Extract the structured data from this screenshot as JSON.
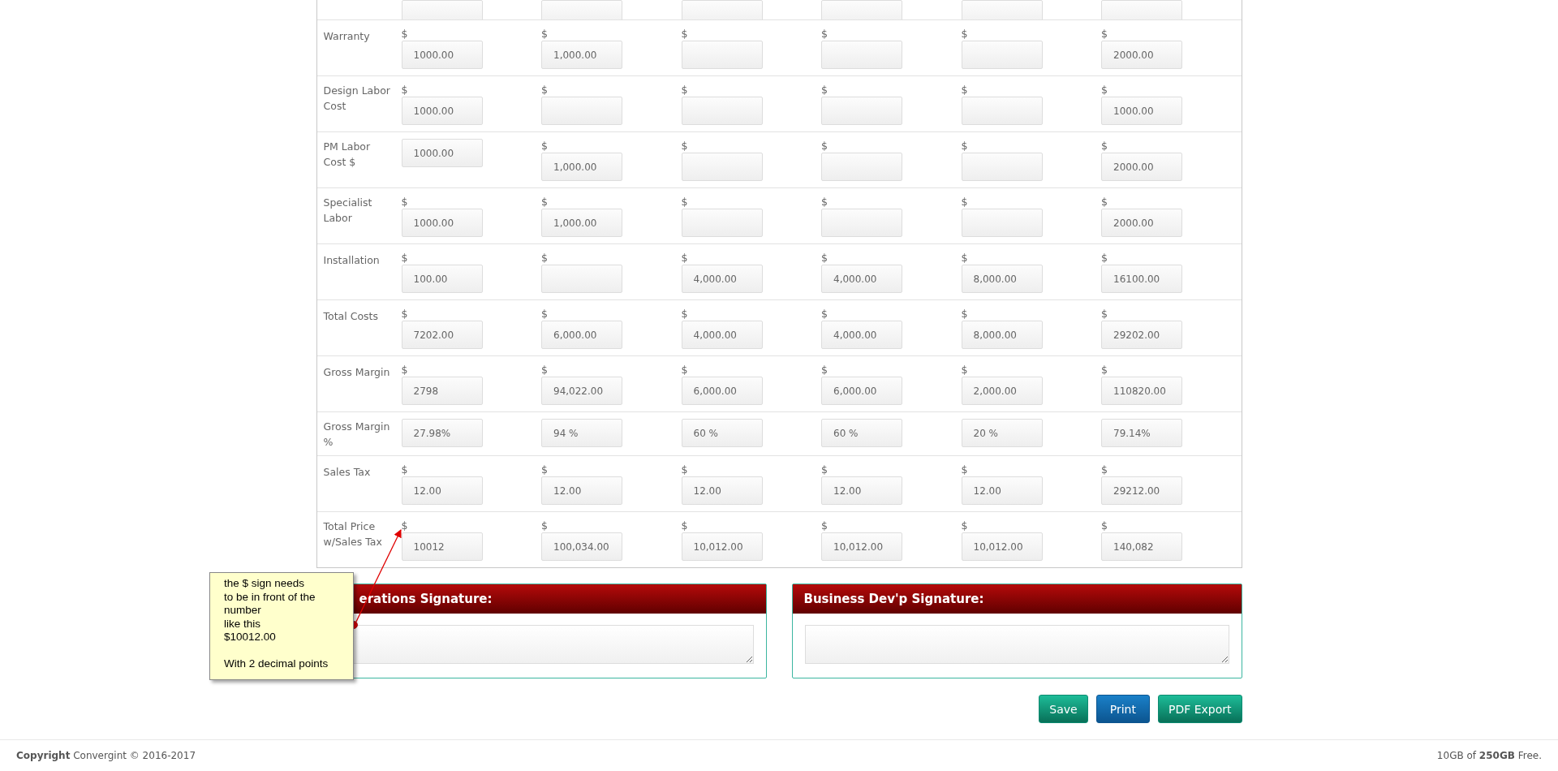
{
  "cost_table": {
    "rows": [
      {
        "label": "Warranty",
        "cells": [
          {
            "currency": "$",
            "value": "1000.00"
          },
          {
            "currency": "$",
            "value": "1,000.00"
          },
          {
            "currency": "$"
          },
          {
            "currency": "$"
          },
          {
            "currency": "$"
          },
          {
            "currency": "$",
            "value": "2000.00"
          }
        ]
      },
      {
        "label": "Design Labor Cost",
        "cells": [
          {
            "currency": "$",
            "value": "1000.00"
          },
          {
            "currency": "$"
          },
          {
            "currency": "$"
          },
          {
            "currency": "$"
          },
          {
            "currency": "$"
          },
          {
            "currency": "$",
            "value": "1000.00"
          }
        ]
      },
      {
        "label": "PM Labor Cost $",
        "cells": [
          {
            "value": "1000.00"
          },
          {
            "currency": "$",
            "value": "1,000.00"
          },
          {
            "currency": "$"
          },
          {
            "currency": "$"
          },
          {
            "currency": "$"
          },
          {
            "currency": "$",
            "value": "2000.00"
          }
        ]
      },
      {
        "label": "Specialist Labor",
        "cells": [
          {
            "currency": "$",
            "value": "1000.00"
          },
          {
            "currency": "$",
            "value": "1,000.00"
          },
          {
            "currency": "$"
          },
          {
            "currency": "$"
          },
          {
            "currency": "$"
          },
          {
            "currency": "$",
            "value": "2000.00"
          }
        ]
      },
      {
        "label": "Installation",
        "cells": [
          {
            "currency": "$",
            "value": "100.00"
          },
          {
            "currency": "$"
          },
          {
            "currency": "$",
            "value": "4,000.00"
          },
          {
            "currency": "$",
            "value": "4,000.00"
          },
          {
            "currency": "$",
            "value": "8,000.00"
          },
          {
            "currency": "$",
            "value": "16100.00"
          }
        ]
      },
      {
        "label": "Total Costs",
        "cells": [
          {
            "currency": "$",
            "value": "7202.00"
          },
          {
            "currency": "$",
            "value": "6,000.00"
          },
          {
            "currency": "$",
            "value": "4,000.00"
          },
          {
            "currency": "$",
            "value": "4,000.00"
          },
          {
            "currency": "$",
            "value": "8,000.00"
          },
          {
            "currency": "$",
            "value": "29202.00"
          }
        ]
      },
      {
        "label": "Gross Margin",
        "cells": [
          {
            "currency": "$",
            "value": "2798"
          },
          {
            "currency": "$",
            "value": "94,022.00"
          },
          {
            "currency": "$",
            "value": "6,000.00"
          },
          {
            "currency": "$",
            "value": "6,000.00"
          },
          {
            "currency": "$",
            "value": "2,000.00"
          },
          {
            "currency": "$",
            "value": "110820.00"
          }
        ]
      },
      {
        "label": "Gross Margin %",
        "cells": [
          {
            "value": "27.98%"
          },
          {
            "value": "94 %"
          },
          {
            "value": "60 %"
          },
          {
            "value": "60 %"
          },
          {
            "value": "20 %"
          },
          {
            "value": "79.14%"
          }
        ]
      },
      {
        "label": "Sales Tax",
        "cells": [
          {
            "currency": "$",
            "value": "12.00"
          },
          {
            "currency": "$",
            "value": "12.00"
          },
          {
            "currency": "$",
            "value": "12.00"
          },
          {
            "currency": "$",
            "value": "12.00"
          },
          {
            "currency": "$",
            "value": "12.00"
          },
          {
            "currency": "$",
            "value": "29212.00"
          }
        ]
      },
      {
        "label": "Total Price w/Sales Tax",
        "cells": [
          {
            "currency": "$",
            "value": "10012"
          },
          {
            "currency": "$",
            "value": "100,034.00"
          },
          {
            "currency": "$",
            "value": "10,012.00"
          },
          {
            "currency": "$",
            "value": "10,012.00"
          },
          {
            "currency": "$",
            "value": "10,012.00"
          },
          {
            "currency": "$",
            "value": "140,082"
          }
        ]
      }
    ]
  },
  "signatures": [
    {
      "title": "erations Signature:"
    },
    {
      "title": "Business Dev'p Signature:"
    }
  ],
  "buttons": [
    {
      "label": "Save",
      "kind": "success"
    },
    {
      "label": "Print",
      "kind": "primary"
    },
    {
      "label": "PDF Export",
      "kind": "success"
    }
  ],
  "annotation": {
    "text": "the $ sign needs\nto be in front of the\nnumber\nlike this\n$10012.00\n\nWith 2 decimal points"
  },
  "footer": {
    "copyright": "**Copyright** Convergint © 2016-2017",
    "storage": "10GB of **250GB** Free."
  }
}
